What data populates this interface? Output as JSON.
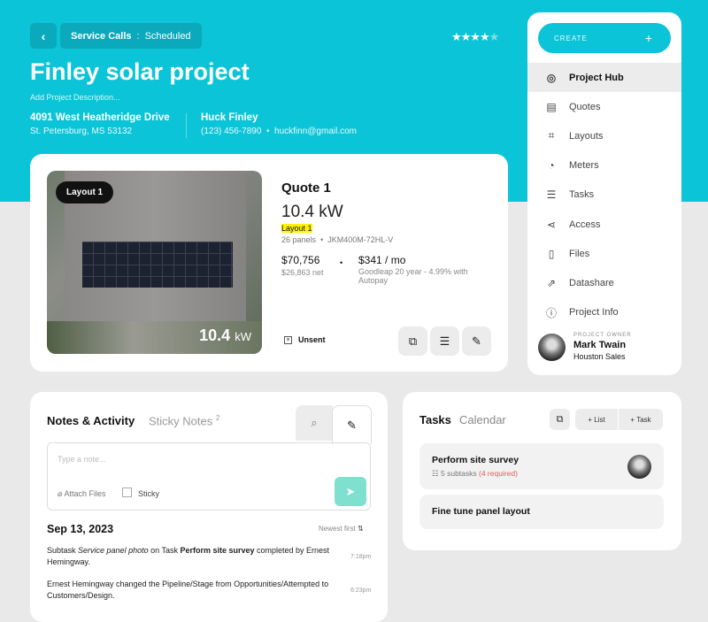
{
  "header": {
    "back_icon": "chevron-left-icon",
    "breadcrumb_section": "Service Calls",
    "breadcrumb_sep": ":",
    "breadcrumb_status": "Scheduled",
    "rating": 4,
    "rating_max": 5,
    "title": "Finley solar project",
    "description_placeholder": "Add Project Description...",
    "address_line1": "4091 West Heatheridge Drive",
    "address_line2": "St. Petersburg, MS 53132",
    "contact_name": "Huck Finley",
    "contact_phone": "(123) 456-7890",
    "contact_email": "huckfinn@gmail.com",
    "contact_sep": "•"
  },
  "quote": {
    "layout_badge": "Layout 1",
    "photo_kw": "10.4",
    "photo_kw_unit": "kW",
    "title": "Quote 1",
    "size": "10.4 kW",
    "layout": "Layout 1",
    "panels": "26 panels",
    "panel_model": "JKM400M-72HL-V",
    "sep": "•",
    "price": "$70,756",
    "net": "$26,863 net",
    "monthly": "$341 / mo",
    "financing": "Goodleap 20 year - 4.99% with Autopay",
    "status": "Unsent",
    "actions": [
      "external-link-icon",
      "list-icon",
      "pencil-icon"
    ]
  },
  "sidebar": {
    "create_label": "CREATE",
    "create_plus": "+",
    "items": [
      {
        "label": "Project Hub",
        "icon": "target-icon",
        "glyph": "◎"
      },
      {
        "label": "Quotes",
        "icon": "calculator-icon",
        "glyph": "▤"
      },
      {
        "label": "Layouts",
        "icon": "layout-icon",
        "glyph": "⌗"
      },
      {
        "label": "Meters",
        "icon": "meter-icon",
        "glyph": "◔"
      },
      {
        "label": "Tasks",
        "icon": "tasks-icon",
        "glyph": "☰"
      },
      {
        "label": "Access",
        "icon": "share-icon",
        "glyph": "⋖"
      },
      {
        "label": "Files",
        "icon": "file-icon",
        "glyph": "▯"
      },
      {
        "label": "Datashare",
        "icon": "datashare-icon",
        "glyph": "⇗"
      },
      {
        "label": "Project Info",
        "icon": "info-icon",
        "glyph": "ⓘ"
      }
    ],
    "owner_label": "PROJECT OWNER",
    "owner_name": "Mark Twain",
    "owner_team": "Houston Sales"
  },
  "notes": {
    "tab_active": "Notes & Activity",
    "tab_inactive": "Sticky Notes",
    "sticky_count": "2",
    "placeholder": "Type a note...",
    "attach": "Attach Files",
    "sticky": "Sticky",
    "date": "Sep 13, 2023",
    "sort": "Newest first",
    "entries": [
      {
        "pre": "Subtask ",
        "italic": "Service panel photo",
        "mid": " on Task ",
        "bold": "Perform site survey",
        "post": " completed by Ernest Hemingway.",
        "time": "7:18pm"
      },
      {
        "text": "Ernest Hemingway changed the Pipeline/Stage from Opportunities/Attempted to Customers/Design.",
        "time": "6:23pm"
      }
    ]
  },
  "tasks": {
    "tab_active": "Tasks",
    "tab_inactive": "Calendar",
    "add_list": "List",
    "add_task": "Task",
    "plus": "+",
    "items": [
      {
        "title": "Perform site survey",
        "subtasks": "5 subtasks",
        "required": "(4 required)"
      },
      {
        "title": "Fine tune panel layout"
      }
    ]
  },
  "colors": {
    "accent": "#0cc4d7",
    "send": "#7fe0cf",
    "required": "#e85a5a",
    "highlight": "#fff200"
  }
}
